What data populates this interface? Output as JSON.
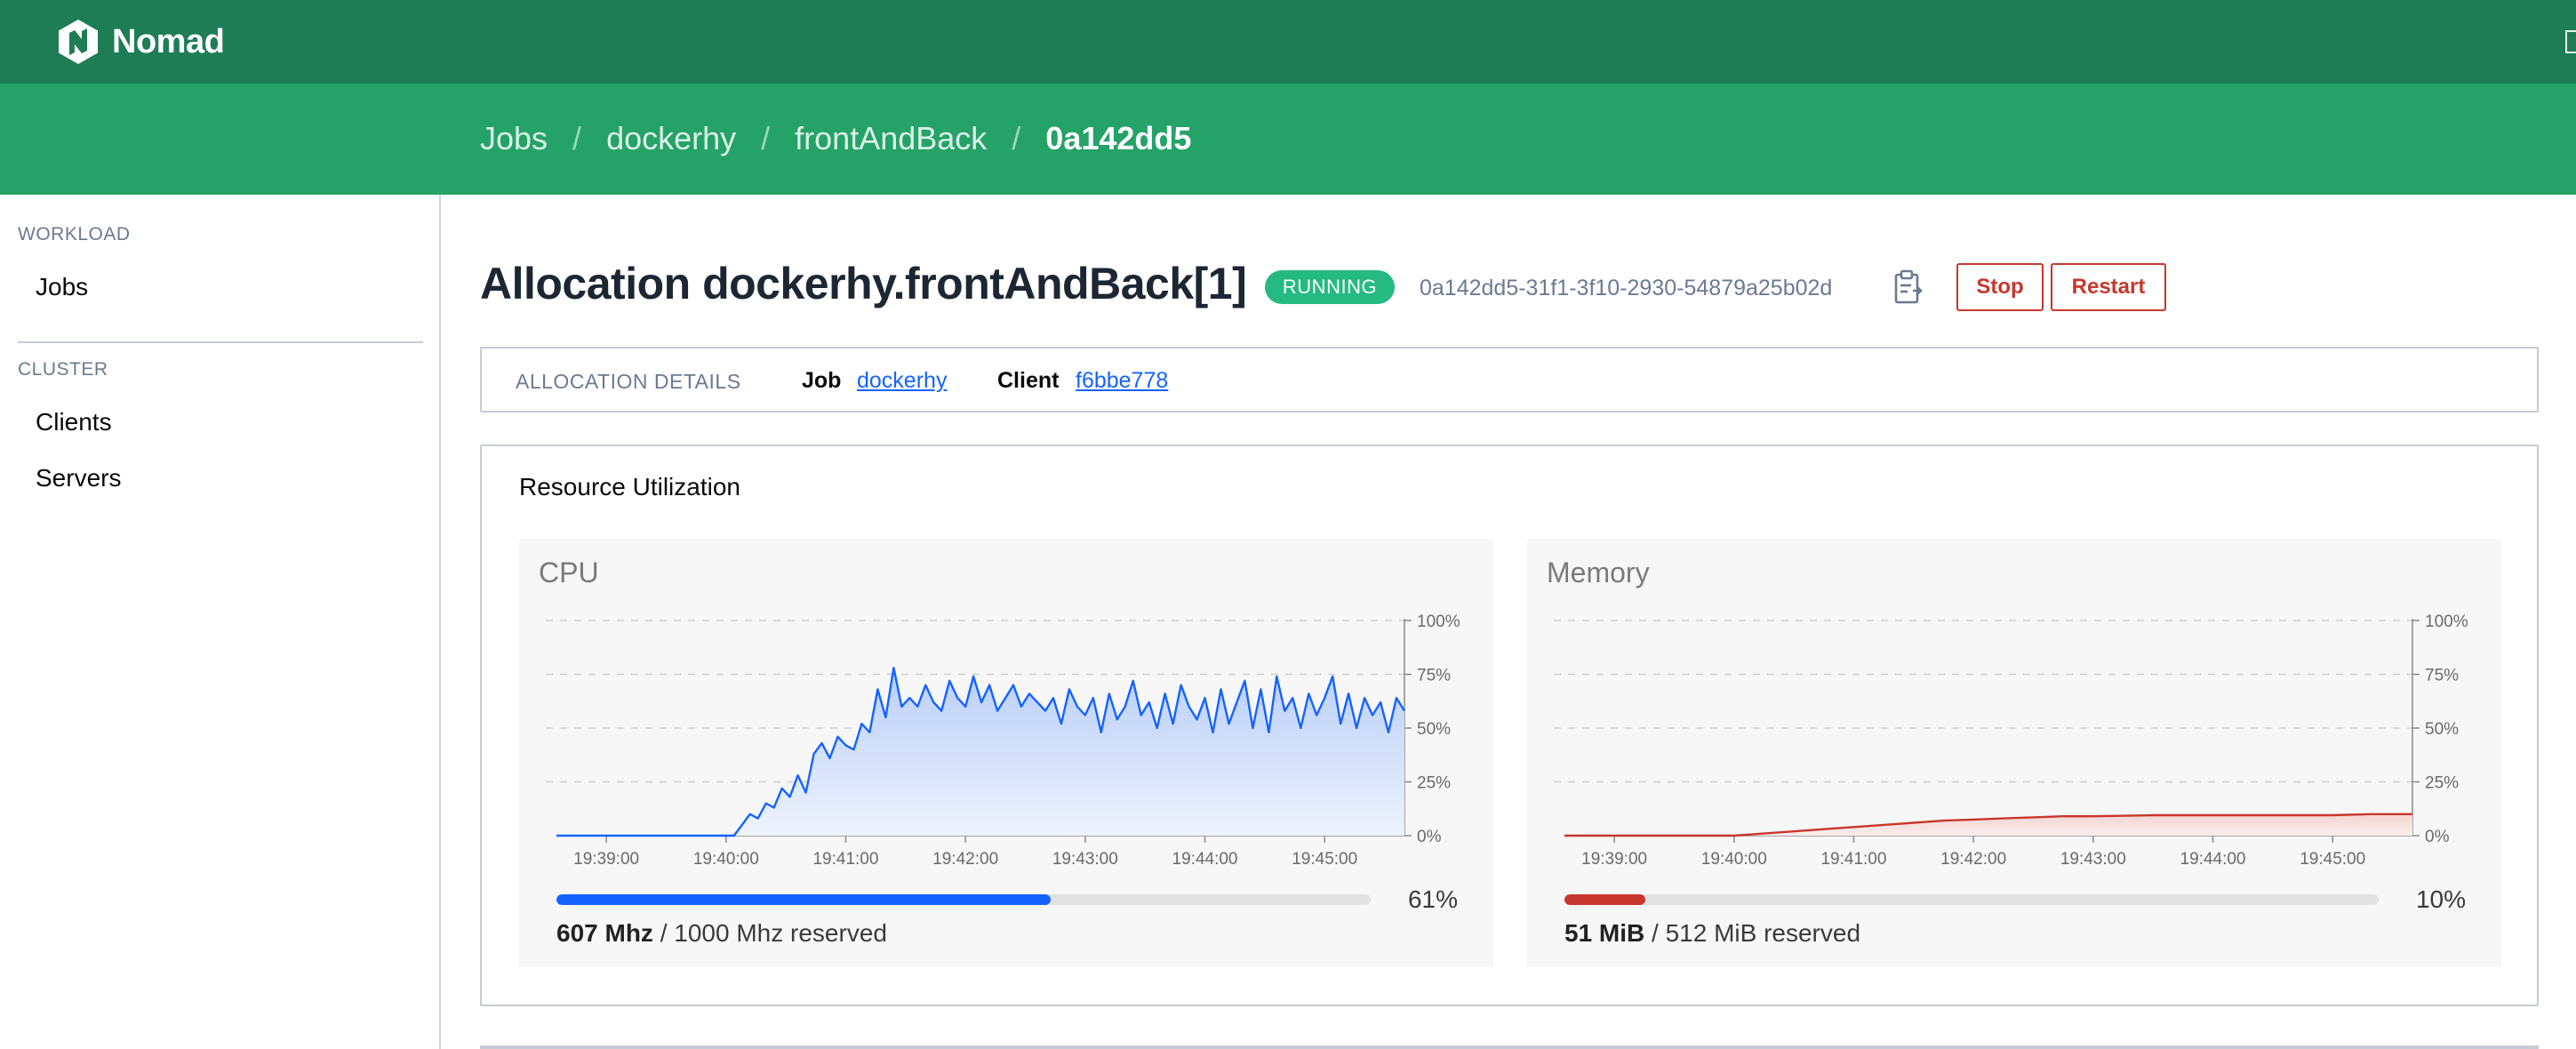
{
  "app": {
    "name": "Nomad"
  },
  "breadcrumbs": [
    {
      "label": "Jobs"
    },
    {
      "label": "dockerhy"
    },
    {
      "label": "frontAndBack"
    },
    {
      "label": "0a142dd5"
    }
  ],
  "sidebar": {
    "sections": [
      {
        "heading": "WORKLOAD",
        "items": [
          {
            "label": "Jobs"
          }
        ]
      },
      {
        "heading": "CLUSTER",
        "items": [
          {
            "label": "Clients"
          },
          {
            "label": "Servers"
          }
        ]
      }
    ]
  },
  "header": {
    "title": "Allocation dockerhy.frontAndBack[1]",
    "status": "RUNNING",
    "allocation_id": "0a142dd5-31f1-3f10-2930-54879a25b02d",
    "copy_icon": "clipboard-icon",
    "stop_label": "Stop",
    "restart_label": "Restart"
  },
  "details": {
    "heading": "ALLOCATION DETAILS",
    "job_label": "Job",
    "job_value": "dockerhy",
    "client_label": "Client",
    "client_value": "f6bbe778"
  },
  "resources": {
    "title": "Resource Utilization",
    "cpu": {
      "title": "CPU",
      "percent_label": "61%",
      "used": "607 Mhz",
      "reserved": " / 1000 Mhz reserved",
      "fraction": 0.607,
      "color": "#1563ff"
    },
    "memory": {
      "title": "Memory",
      "percent_label": "10%",
      "used": "51 MiB",
      "reserved": " / 512 MiB reserved",
      "fraction": 0.0996,
      "color": "#c8372d"
    }
  },
  "chart_data": [
    {
      "type": "area",
      "title": "CPU",
      "y_ticks": [
        "100%",
        "75%",
        "50%",
        "25%",
        "0%"
      ],
      "x_ticks": [
        "19:39:00",
        "19:40:00",
        "19:41:00",
        "19:42:00",
        "19:43:00",
        "19:44:00",
        "19:45:00"
      ],
      "ylim": [
        0,
        100
      ],
      "x_range": [
        "19:38:35",
        "19:45:40"
      ],
      "series": [
        {
          "x": [
            "19:38:35",
            "19:38:45",
            "19:38:55",
            "19:39:05",
            "19:39:15",
            "19:39:25",
            "19:39:35",
            "19:39:45",
            "19:39:55",
            "19:40:04",
            "19:40:08",
            "19:40:12",
            "19:40:16",
            "19:40:20",
            "19:40:24",
            "19:40:28",
            "19:40:32",
            "19:40:36",
            "19:40:40",
            "19:40:44",
            "19:40:48",
            "19:40:52",
            "19:40:56",
            "19:41:00",
            "19:41:04",
            "19:41:08",
            "19:41:12",
            "19:41:16",
            "19:41:20",
            "19:41:24",
            "19:41:28",
            "19:41:32",
            "19:41:36",
            "19:41:40",
            "19:41:44",
            "19:41:48",
            "19:41:52",
            "19:41:56",
            "19:42:00",
            "19:42:04",
            "19:42:08",
            "19:42:12",
            "19:42:16",
            "19:42:20",
            "19:42:24",
            "19:42:28",
            "19:42:32",
            "19:42:36",
            "19:42:40",
            "19:42:44",
            "19:42:48",
            "19:42:52",
            "19:42:56",
            "19:43:00",
            "19:43:04",
            "19:43:08",
            "19:43:12",
            "19:43:16",
            "19:43:20",
            "19:43:24",
            "19:43:28",
            "19:43:32",
            "19:43:36",
            "19:43:40",
            "19:43:44",
            "19:43:48",
            "19:43:52",
            "19:43:56",
            "19:44:00",
            "19:44:04",
            "19:44:08",
            "19:44:12",
            "19:44:16",
            "19:44:20",
            "19:44:24",
            "19:44:28",
            "19:44:32",
            "19:44:36",
            "19:44:40",
            "19:44:44",
            "19:44:48",
            "19:44:52",
            "19:44:56",
            "19:45:00",
            "19:45:04",
            "19:45:08",
            "19:45:12",
            "19:45:16",
            "19:45:20",
            "19:45:24",
            "19:45:28",
            "19:45:32",
            "19:45:36",
            "19:45:40"
          ],
          "values": [
            0,
            0,
            0,
            0,
            0,
            0,
            0,
            0,
            0,
            0,
            5,
            10,
            8,
            15,
            13,
            22,
            18,
            28,
            20,
            38,
            43,
            36,
            46,
            42,
            40,
            52,
            48,
            68,
            55,
            78,
            60,
            64,
            60,
            70,
            62,
            58,
            72,
            64,
            60,
            74,
            62,
            70,
            58,
            64,
            70,
            60,
            66,
            62,
            58,
            64,
            52,
            68,
            60,
            56,
            64,
            48,
            66,
            54,
            60,
            72,
            56,
            62,
            50,
            66,
            52,
            70,
            60,
            54,
            64,
            48,
            68,
            52,
            62,
            72,
            50,
            68,
            48,
            74,
            58,
            64,
            50,
            66,
            56,
            64,
            74,
            52,
            66,
            50,
            64,
            56,
            62,
            48,
            64,
            58
          ]
        }
      ]
    },
    {
      "type": "area",
      "title": "Memory",
      "y_ticks": [
        "100%",
        "75%",
        "50%",
        "25%",
        "0%"
      ],
      "x_ticks": [
        "19:39:00",
        "19:40:00",
        "19:41:00",
        "19:42:00",
        "19:43:00",
        "19:44:00",
        "19:45:00"
      ],
      "ylim": [
        0,
        100
      ],
      "x_range": [
        "19:38:35",
        "19:45:40"
      ],
      "series": [
        {
          "x": [
            "19:38:35",
            "19:39:00",
            "19:39:30",
            "19:40:00",
            "19:40:15",
            "19:40:30",
            "19:40:45",
            "19:41:00",
            "19:41:15",
            "19:41:30",
            "19:41:45",
            "19:42:00",
            "19:42:15",
            "19:42:30",
            "19:42:45",
            "19:43:00",
            "19:43:30",
            "19:44:00",
            "19:44:30",
            "19:45:00",
            "19:45:20",
            "19:45:40"
          ],
          "values": [
            0,
            0,
            0,
            0,
            1,
            2,
            3,
            4,
            5,
            6,
            7,
            7.5,
            8,
            8.5,
            9,
            9,
            9.5,
            9.5,
            9.5,
            9.5,
            10,
            10
          ]
        }
      ]
    }
  ]
}
